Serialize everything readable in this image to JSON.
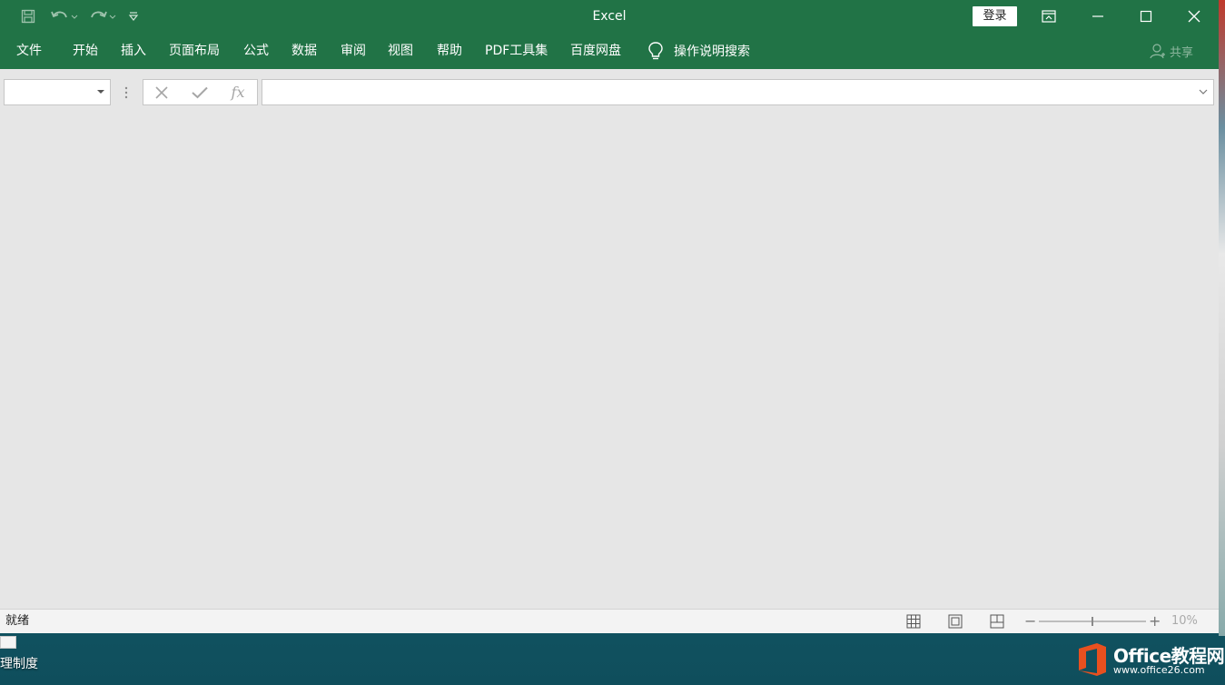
{
  "window": {
    "title": "Excel",
    "login_label": "登录"
  },
  "ribbon": {
    "tabs": [
      {
        "label": "文件"
      },
      {
        "label": "开始"
      },
      {
        "label": "插入"
      },
      {
        "label": "页面布局"
      },
      {
        "label": "公式"
      },
      {
        "label": "数据"
      },
      {
        "label": "审阅"
      },
      {
        "label": "视图"
      },
      {
        "label": "帮助"
      },
      {
        "label": "PDF工具集"
      },
      {
        "label": "百度网盘"
      }
    ],
    "tell_me": "操作说明搜索",
    "share": "共享"
  },
  "formula_bar": {
    "name_box_value": "",
    "fx_label": "fx",
    "formula_value": ""
  },
  "status_bar": {
    "status": "就绪",
    "zoom": {
      "minus": "−",
      "plus": "+",
      "level_label": "10%",
      "slider_fraction": 0.5
    }
  },
  "desktop": {
    "file_label": "理制度",
    "watermark_brand": "Office教程网",
    "watermark_site": "www.office26.com"
  },
  "colors": {
    "excel_green": "#217346",
    "workspace_gray": "#e6e6e6",
    "statusbar": "#f3f3f3",
    "watermark_orange": "#e8501f"
  },
  "icons": {
    "qat": [
      "save-icon",
      "undo-icon",
      "redo-icon",
      "customize-qat-icon"
    ],
    "window": [
      "ribbon-display-icon",
      "minimize-icon",
      "maximize-icon",
      "close-icon"
    ],
    "tell_me": "lightbulb-icon",
    "share": "person-icon",
    "views": [
      "normal-view-icon",
      "page-layout-view-icon",
      "page-break-preview-icon"
    ]
  }
}
